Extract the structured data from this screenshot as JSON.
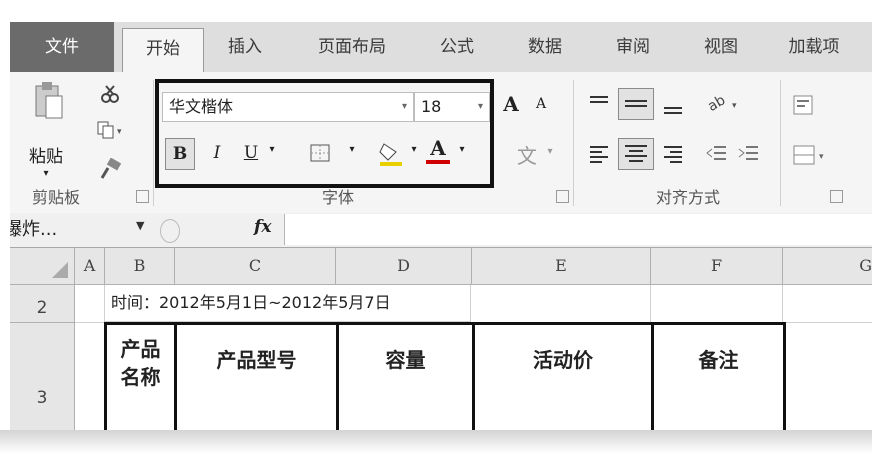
{
  "tabs": [
    "文件",
    "开始",
    "插入",
    "页面布局",
    "公式",
    "数据",
    "审阅",
    "视图",
    "加载项"
  ],
  "clipboard": {
    "paste_label": "粘贴",
    "group_label": "剪贴板"
  },
  "font": {
    "name": "华文楷体",
    "size": "18",
    "bold": "B",
    "italic": "I",
    "underline": "U",
    "grow": "A",
    "shrink": "A",
    "font_color": "A",
    "phonetic": "文",
    "group_label": "字体"
  },
  "alignment": {
    "group_label": "对齐方式"
  },
  "formula_bar": {
    "name_box": "爆炸...",
    "fx": "fx",
    "value": ""
  },
  "sheet": {
    "columns": [
      "A",
      "B",
      "C",
      "D",
      "E",
      "F",
      "G"
    ],
    "rows": [
      "2",
      "3"
    ],
    "date_text": "时间：2012年5月1日~2012年5月7日",
    "header_cells": [
      "产品名称",
      "产品型号",
      "容量",
      "活动价",
      "备注"
    ]
  },
  "colors": {
    "highlight_border": "#111111",
    "file_tab": "#6b6b6b",
    "font_color_bar": "#d00000"
  }
}
